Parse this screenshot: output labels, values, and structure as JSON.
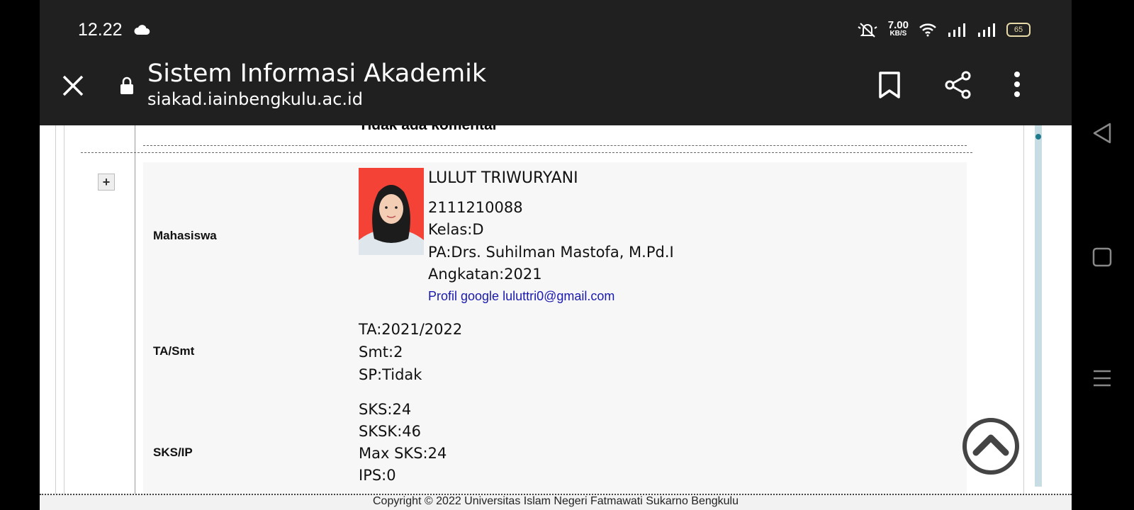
{
  "status_bar": {
    "time": "12.22",
    "net_speed_value": "7.00",
    "net_speed_unit": "KB/S",
    "battery": "65",
    "icons": [
      "cloud-icon",
      "mute-bell-icon",
      "wifi-icon",
      "signal-icon",
      "signal-icon-2",
      "battery-icon"
    ]
  },
  "toolbar": {
    "title": "Sistem Informasi Akademik",
    "url": "siakad.iainbengkulu.ac.id",
    "icons": [
      "close-icon",
      "lock-icon",
      "bookmark-icon",
      "share-icon",
      "more-vert-icon"
    ]
  },
  "content": {
    "top_label": "Tidak ada komentar",
    "expand_label": "+",
    "rows": {
      "mahasiswa_label": "Mahasiswa",
      "tasmt_label": "TA/Smt",
      "sksip_label": "SKS/IP"
    },
    "student": {
      "name": "LULUT TRIWURYANI",
      "nim": "2111210088",
      "kelas": "Kelas:D",
      "pa": "PA:Drs. Suhilman Mastofa, M.Pd.I",
      "angkatan": "Angkatan:2021",
      "google_profile": "Profil google luluttri0@gmail.com"
    },
    "ta_smt": {
      "ta": "TA:2021/2022",
      "smt": "Smt:2",
      "sp": "SP:Tidak"
    },
    "sks_ip": {
      "sks": "SKS:24",
      "sksk": "SKSK:46",
      "max_sks": "Max SKS:24",
      "ips": "IPS:0"
    }
  },
  "footer": {
    "copyright": "Copyright © 2022 Universitas Islam Negeri Fatmawati Sukarno Bengkulu"
  },
  "nav_bar": {
    "icons": [
      "back-triangle-icon",
      "home-square-icon",
      "recents-menu-icon"
    ]
  },
  "colors": {
    "toolbar_bg": "#202020",
    "photo_bg": "#f44236",
    "link": "#1a1ab0",
    "scroll_thumb": "#1f7a8c"
  }
}
